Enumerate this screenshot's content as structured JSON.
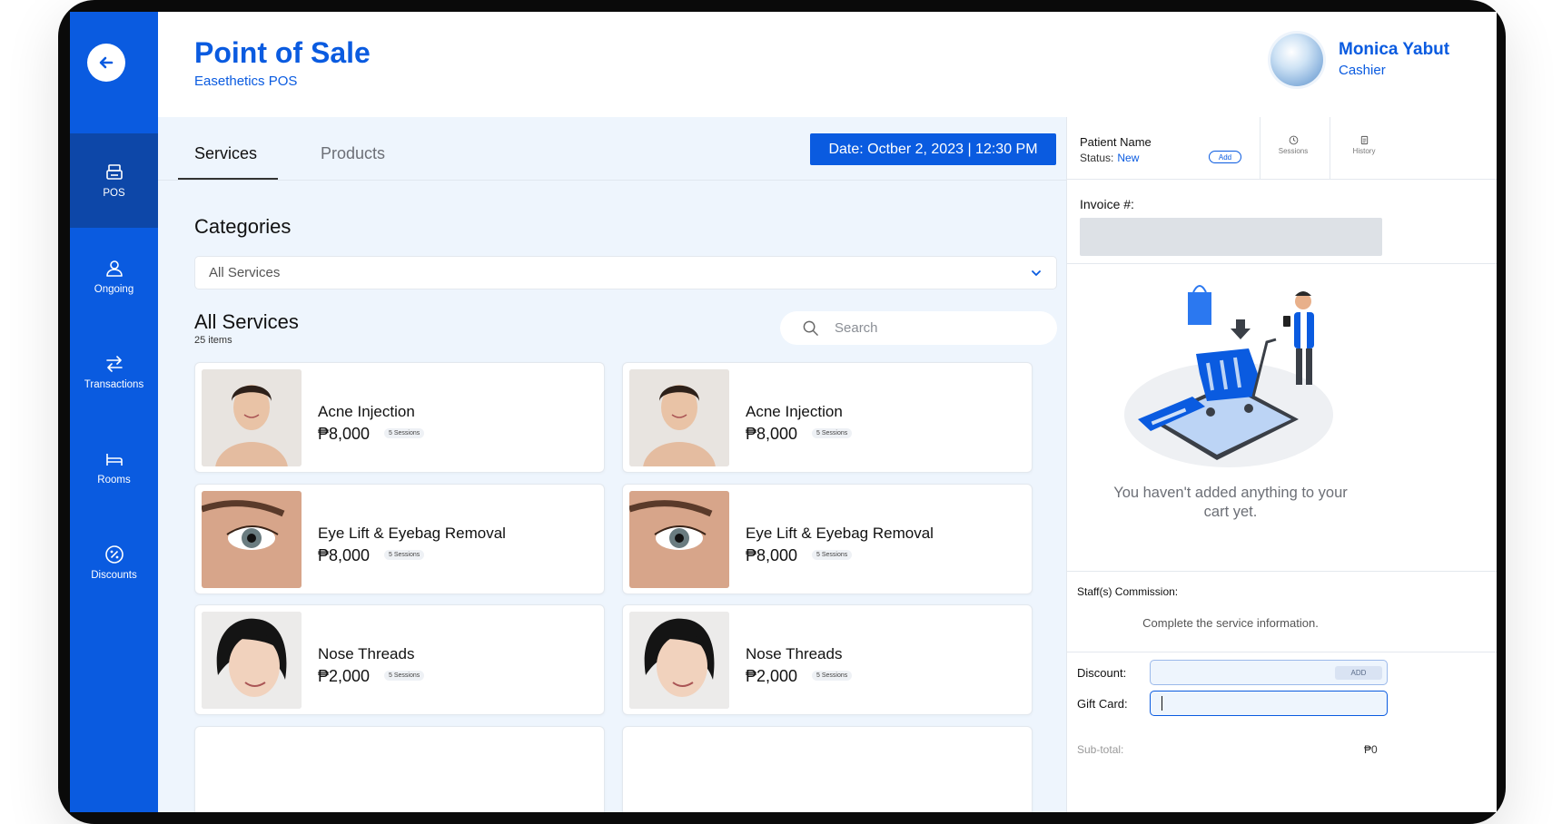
{
  "header": {
    "title": "Point of Sale",
    "subtitle": "Easethetics POS",
    "user_name": "Monica Yabut",
    "user_role": "Cashier"
  },
  "sidebar": {
    "items": [
      {
        "label": "POS",
        "icon": "printer-icon",
        "active": true
      },
      {
        "label": "Ongoing",
        "icon": "user-icon",
        "active": false
      },
      {
        "label": "Transactions",
        "icon": "arrows-swap-icon",
        "active": false
      },
      {
        "label": "Rooms",
        "icon": "bed-icon",
        "active": false
      },
      {
        "label": "Discounts",
        "icon": "percent-icon",
        "active": false
      }
    ]
  },
  "tabs": {
    "services": "Services",
    "products": "Products"
  },
  "date_badge": "Date: Octber 2, 2023 | 12:30 PM",
  "categories": {
    "title": "Categories",
    "selected": "All Services"
  },
  "services_list": {
    "title": "All Services",
    "count": "25 items",
    "search_placeholder": "Search"
  },
  "services": [
    {
      "name": "Acne Injection",
      "price": "₱8,000",
      "sessions": "5 Sessions"
    },
    {
      "name": "Acne Injection",
      "price": "₱8,000",
      "sessions": "5 Sessions"
    },
    {
      "name": "Eye Lift & Eyebag Removal",
      "price": "₱8,000",
      "sessions": "5 Sessions"
    },
    {
      "name": "Eye Lift & Eyebag Removal",
      "price": "₱8,000",
      "sessions": "5 Sessions"
    },
    {
      "name": "Nose Threads",
      "price": "₱2,000",
      "sessions": "5 Sessions"
    },
    {
      "name": "Nose Threads",
      "price": "₱2,000",
      "sessions": "5 Sessions"
    }
  ],
  "patient": {
    "label": "Patient Name",
    "status_label": "Status:",
    "status_value": "New",
    "add_label": "Add",
    "sessions_label": "Sessions",
    "history_label": "History"
  },
  "invoice": {
    "label": "Invoice #:"
  },
  "cart": {
    "empty_message": "You haven't added anything to your cart yet."
  },
  "commission": {
    "label": "Staff(s) Commission:",
    "message": "Complete the service information."
  },
  "discount": {
    "label": "Discount:",
    "add_label": "ADD"
  },
  "gift_card": {
    "label": "Gift Card:"
  },
  "subtotal": {
    "label": "Sub-total:",
    "value": "₱0"
  },
  "colors": {
    "brand": "#0a5be0",
    "sidebar_active": "#0d47a8",
    "main_bg": "#eef5fd"
  }
}
